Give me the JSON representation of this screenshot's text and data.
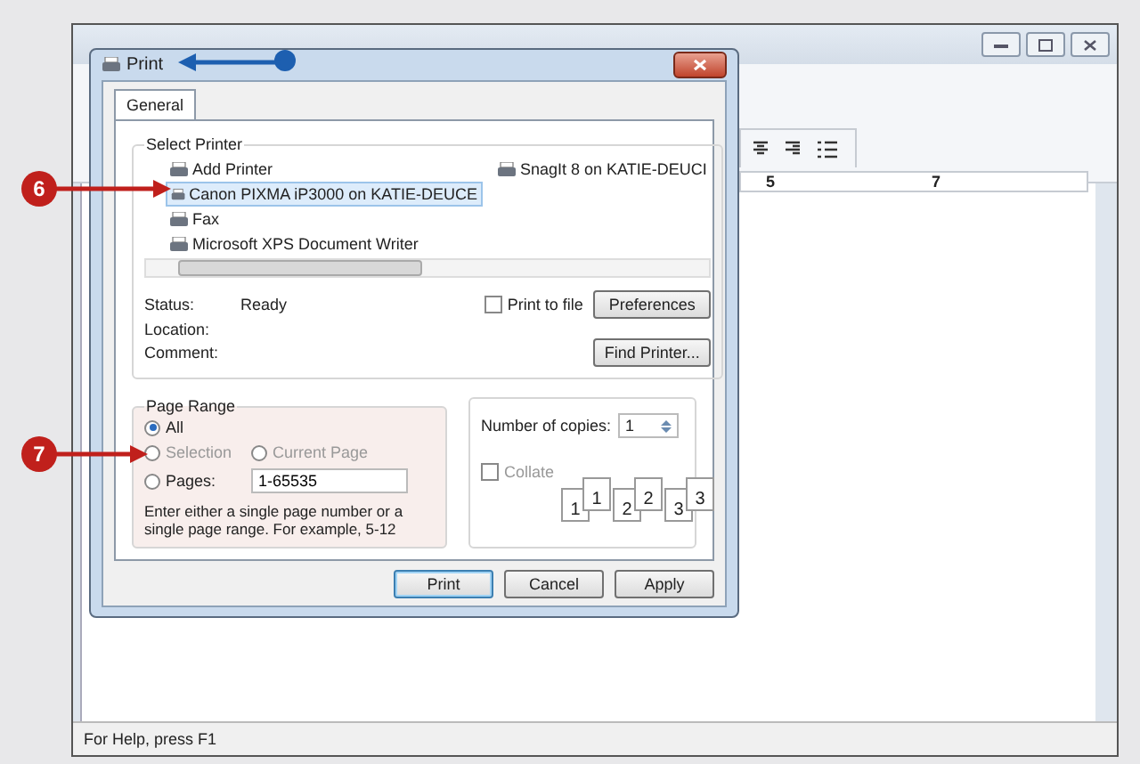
{
  "wordpad": {
    "ruler_numbers": [
      "5",
      "7"
    ],
    "status_bar": "For Help, press F1"
  },
  "dialog": {
    "title": "Print",
    "tabs": [
      {
        "label": "General",
        "selected": true
      }
    ],
    "select_printer": {
      "label": "Select Printer",
      "printers": [
        {
          "name": "Add Printer",
          "selected": false
        },
        {
          "name": "Canon PIXMA iP3000 on KATIE-DEUCE",
          "selected": true
        },
        {
          "name": "Fax",
          "selected": false
        },
        {
          "name": "Microsoft XPS Document Writer",
          "selected": false
        },
        {
          "name": "SnagIt 8 on KATIE-DEUCI",
          "selected": false
        }
      ],
      "status_label": "Status:",
      "status": "Ready",
      "location_label": "Location:",
      "comment_label": "Comment:",
      "print_to_file": {
        "label": "Print to file",
        "checked": false
      },
      "preferences": "Preferences",
      "find_printer": "Find Printer..."
    },
    "page_range": {
      "label": "Page Range",
      "options": [
        {
          "label": "All",
          "selected": true,
          "disabled": false
        },
        {
          "label": "Selection",
          "selected": false,
          "disabled": true
        },
        {
          "label": "Current Page",
          "selected": false,
          "disabled": true
        },
        {
          "label": "Pages:",
          "selected": false,
          "disabled": false
        }
      ],
      "pages_value": "1-65535",
      "hint": "Enter either a single page number or a single page range.  For example, 5-12"
    },
    "copies": {
      "label": "Number of copies:",
      "value": "1",
      "collate": {
        "label": "Collate",
        "checked": false,
        "disabled": true
      },
      "collate_pages": [
        "1",
        "1",
        "2",
        "2",
        "3",
        "3"
      ]
    },
    "buttons": [
      "Print",
      "Cancel",
      "Apply"
    ]
  },
  "callouts": [
    {
      "number": "6"
    },
    {
      "number": "7"
    }
  ]
}
